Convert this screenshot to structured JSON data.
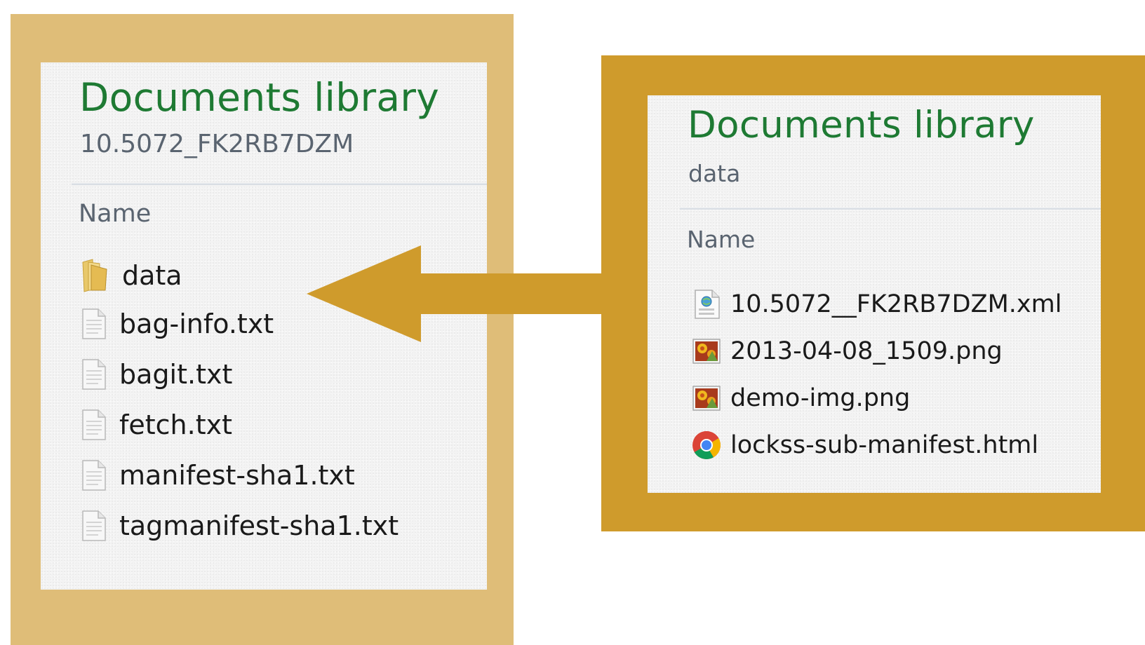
{
  "left_pane": {
    "title": "Documents library",
    "subtitle": "10.5072_FK2RB7DZM",
    "column_header": "Name",
    "items": [
      {
        "name": "data",
        "icon": "folder-icon"
      },
      {
        "name": "bag-info.txt",
        "icon": "text-file-icon"
      },
      {
        "name": "bagit.txt",
        "icon": "text-file-icon"
      },
      {
        "name": "fetch.txt",
        "icon": "text-file-icon"
      },
      {
        "name": "manifest-sha1.txt",
        "icon": "text-file-icon"
      },
      {
        "name": "tagmanifest-sha1.txt",
        "icon": "text-file-icon"
      }
    ]
  },
  "right_pane": {
    "title": "Documents library",
    "subtitle": "data",
    "column_header": "Name",
    "items": [
      {
        "name": "10.5072__FK2RB7DZM.xml",
        "icon": "xml-file-icon"
      },
      {
        "name": "2013-04-08_1509.png",
        "icon": "image-file-icon"
      },
      {
        "name": "demo-img.png",
        "icon": "image-file-icon"
      },
      {
        "name": "lockss-sub-manifest.html",
        "icon": "chrome-html-icon"
      }
    ]
  },
  "colors": {
    "left_frame": "#dfbd78",
    "right_frame": "#cf9b2c",
    "arrow": "#cf9b2c",
    "title_green": "#1e7a33"
  }
}
